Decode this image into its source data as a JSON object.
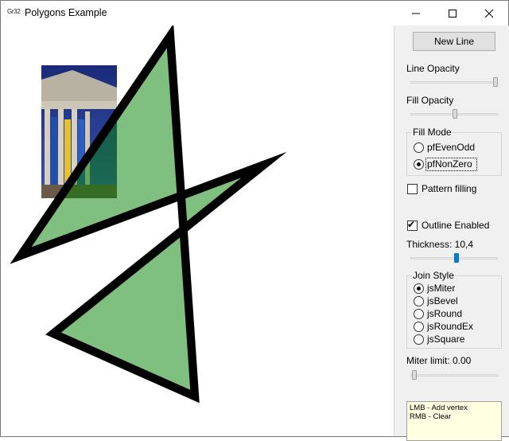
{
  "window": {
    "title": "Polygons Example",
    "app_icon_text": "Gr32"
  },
  "panel": {
    "new_line_label": "New Line",
    "line_opacity_label": "Line Opacity",
    "line_opacity_value": 1.0,
    "fill_opacity_label": "Fill Opacity",
    "fill_opacity_value": 0.5,
    "fill_mode": {
      "title": "Fill Mode",
      "options": [
        "pfEvenOdd",
        "pfNonZero"
      ],
      "selected": "pfNonZero"
    },
    "pattern_filling_label": "Pattern filling",
    "pattern_filling_checked": false,
    "outline_enabled_label": "Outline Enabled",
    "outline_enabled_checked": true,
    "thickness_label": "Thickness: 10,4",
    "join_style": {
      "title": "Join Style",
      "options": [
        "jsMiter",
        "jsBevel",
        "jsRound",
        "jsRoundEx",
        "jsSquare"
      ],
      "selected": "jsMiter"
    },
    "miter_limit_label": "Miter limit: 0.00",
    "help_lines": [
      "LMB - Add vertex",
      "RMB - Clear"
    ]
  },
  "colors": {
    "fill": "#80c080",
    "outline": "#000000",
    "accent": "#007ad9",
    "help_bg": "#ffffe1"
  }
}
